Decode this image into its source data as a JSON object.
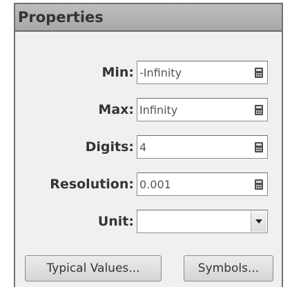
{
  "panel": {
    "title": "Properties"
  },
  "fields": {
    "min": {
      "label": "Min:",
      "value": "-Infinity"
    },
    "max": {
      "label": "Max:",
      "value": "Infinity"
    },
    "digits": {
      "label": "Digits:",
      "value": "4"
    },
    "resolution": {
      "label": "Resolution:",
      "value": "0.001"
    },
    "unit": {
      "label": "Unit:",
      "value": ""
    }
  },
  "buttons": {
    "typical_values": "Typical Values...",
    "symbols": "Symbols..."
  },
  "icons": {
    "calculator": "calculator-icon",
    "dropdown": "chevron-down-icon"
  }
}
